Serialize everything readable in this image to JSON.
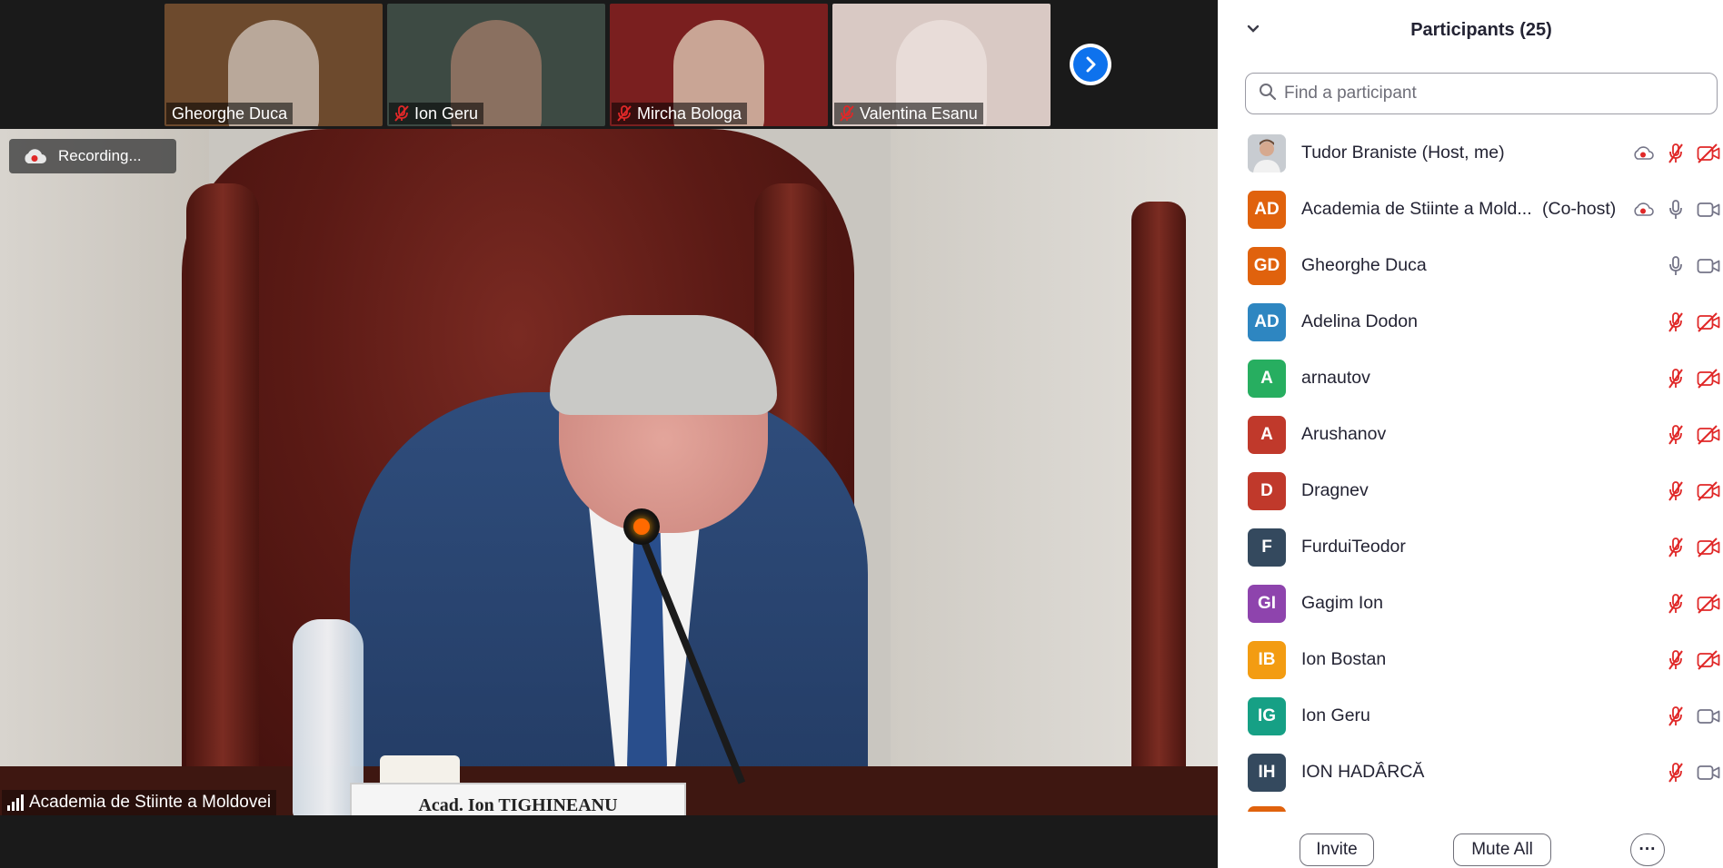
{
  "thumbnails": [
    {
      "name": "Gheorghe Duca",
      "muted": false,
      "bg": "#6d4a2d",
      "person": "#b9a89a"
    },
    {
      "name": "Ion Geru",
      "muted": true,
      "bg": "#3d4a43",
      "person": "#8a7060"
    },
    {
      "name": "Mircha Bologa",
      "muted": true,
      "bg": "#7a1f1f",
      "person": "#c9a595"
    },
    {
      "name": "Valentina Esanu",
      "muted": true,
      "bg": "#d9c9c4",
      "person": "#e8dcd8"
    }
  ],
  "next_arrow_icon": "chevron-right-icon",
  "recording": {
    "label": "Recording...",
    "icon": "cloud-record-icon"
  },
  "main_video": {
    "speaker_label": "Academia de Stiinte a Moldovei",
    "nameplate": "Acad. Ion TIGHINEANU"
  },
  "panel": {
    "title": "Participants (25)",
    "search_placeholder": "Find a participant",
    "collapse_icon": "chevron-down-icon"
  },
  "participants": [
    {
      "initials": "",
      "name": "Tudor Braniste (Host, me)",
      "role": "",
      "color": "#9aa5b5",
      "photo": true,
      "recording": true,
      "mic": "muted",
      "video": "off"
    },
    {
      "initials": "AD",
      "name": "Academia de Stiinte a Mold...",
      "role": "(Co-host)",
      "color": "#e0620d",
      "photo": false,
      "recording": true,
      "mic": "on",
      "video": "on"
    },
    {
      "initials": "GD",
      "name": "Gheorghe Duca",
      "role": "",
      "color": "#e0620d",
      "photo": false,
      "recording": false,
      "mic": "on",
      "video": "on"
    },
    {
      "initials": "AD",
      "name": "Adelina Dodon",
      "role": "",
      "color": "#2e86c1",
      "photo": false,
      "recording": false,
      "mic": "muted",
      "video": "off"
    },
    {
      "initials": "A",
      "name": "arnautov",
      "role": "",
      "color": "#27ae60",
      "photo": false,
      "recording": false,
      "mic": "muted",
      "video": "off"
    },
    {
      "initials": "A",
      "name": "Arushanov",
      "role": "",
      "color": "#c0392b",
      "photo": false,
      "recording": false,
      "mic": "muted",
      "video": "off"
    },
    {
      "initials": "D",
      "name": "Dragnev",
      "role": "",
      "color": "#c0392b",
      "photo": false,
      "recording": false,
      "mic": "muted",
      "video": "off"
    },
    {
      "initials": "F",
      "name": "FurduiTeodor",
      "role": "",
      "color": "#34495e",
      "photo": false,
      "recording": false,
      "mic": "muted",
      "video": "off"
    },
    {
      "initials": "GI",
      "name": "Gagim Ion",
      "role": "",
      "color": "#8e44ad",
      "photo": false,
      "recording": false,
      "mic": "muted",
      "video": "off"
    },
    {
      "initials": "IB",
      "name": "Ion Bostan",
      "role": "",
      "color": "#f39c12",
      "photo": false,
      "recording": false,
      "mic": "muted",
      "video": "off"
    },
    {
      "initials": "IG",
      "name": "Ion Geru",
      "role": "",
      "color": "#16a085",
      "photo": false,
      "recording": false,
      "mic": "muted",
      "video": "on"
    },
    {
      "initials": "IH",
      "name": "ION HADÂRCĂ",
      "role": "",
      "color": "#34495e",
      "photo": false,
      "recording": false,
      "mic": "muted",
      "video": "on"
    }
  ],
  "footer": {
    "invite_label": "Invite",
    "mute_all_label": "Mute All",
    "more_label": "···"
  },
  "colors": {
    "muted_red": "#e02828",
    "zoom_blue": "#0e72ed",
    "icon_gray": "#747487"
  }
}
